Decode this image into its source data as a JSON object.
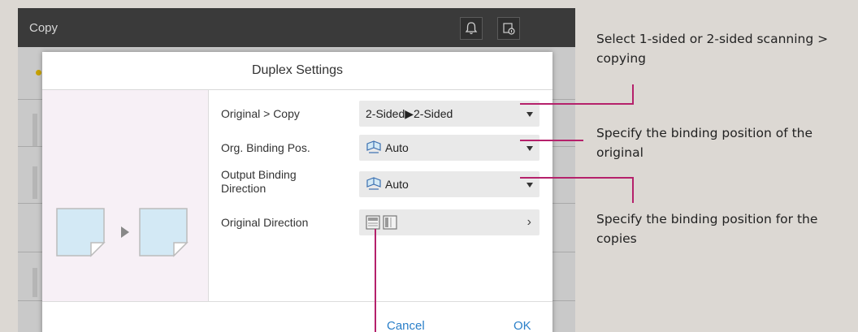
{
  "screen": {
    "title": "Copy",
    "icons": [
      "bell-icon",
      "device-status-icon"
    ]
  },
  "dialog": {
    "title": "Duplex Settings",
    "rows": [
      {
        "label": "Original > Copy",
        "value": "2-Sided▶2-Sided",
        "control": "dropdown"
      },
      {
        "label": "Org. Binding Pos.",
        "value": "Auto",
        "control": "dropdown",
        "icon": "binding-icon"
      },
      {
        "label": "Output Binding Direction",
        "value": "Auto",
        "control": "dropdown",
        "icon": "binding-icon"
      },
      {
        "label": "Original Direction",
        "value": "",
        "control": "submenu",
        "icon": "orientation-icons"
      }
    ],
    "cancel_label": "Cancel",
    "ok_label": "OK"
  },
  "callouts": {
    "scan_mode": "Select 1-sided or 2-sided scanning > copying",
    "org_binding": "Specify the binding position of the original",
    "output_binding": "Specify the binding position for the copies"
  },
  "colors": {
    "accent_line": "#b5216b",
    "link_blue": "#2a7fc9",
    "topbar": "#3a3a3a",
    "left_panel": "#f7f0f6"
  }
}
